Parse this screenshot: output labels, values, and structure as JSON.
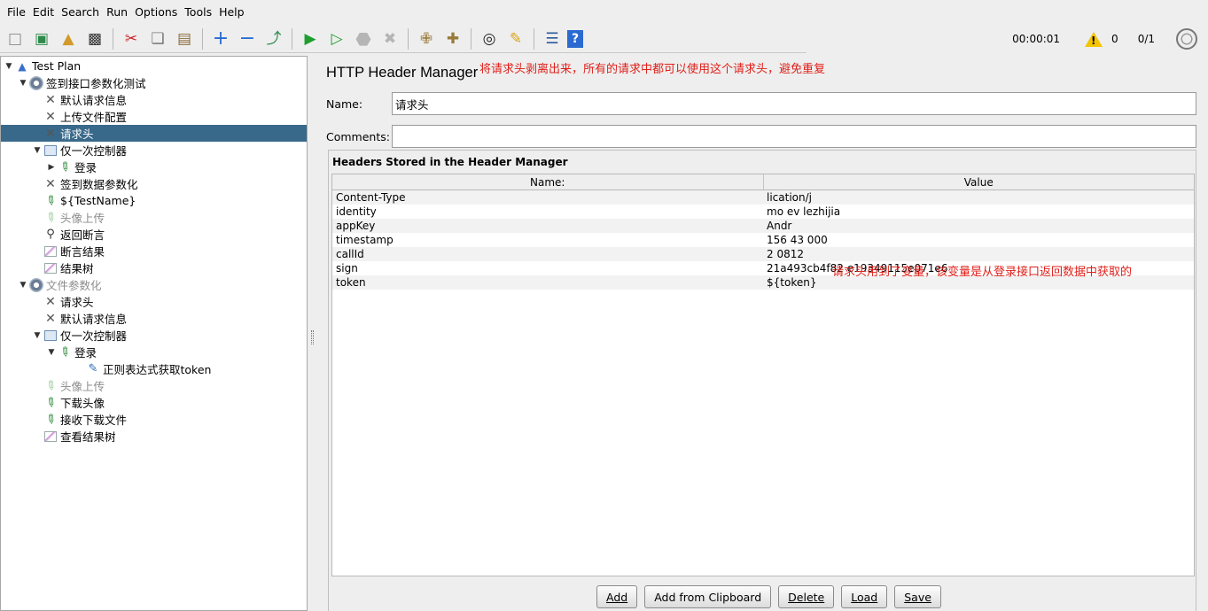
{
  "menubar": {
    "items": [
      "File",
      "Edit",
      "Search",
      "Run",
      "Options",
      "Tools",
      "Help"
    ]
  },
  "toolbar": {
    "buttons": [
      {
        "name": "new-icon",
        "glyph": "🗋"
      },
      {
        "name": "templates-icon",
        "glyph": "📚"
      },
      {
        "name": "open-icon",
        "glyph": "📂"
      },
      {
        "name": "save-icon",
        "glyph": "💾"
      },
      {
        "name": "cut-icon",
        "glyph": "✂"
      },
      {
        "name": "copy-icon",
        "glyph": "⎘"
      },
      {
        "name": "paste-icon",
        "glyph": "📋"
      },
      {
        "name": "expand-icon",
        "glyph": "+"
      },
      {
        "name": "collapse-icon",
        "glyph": "−"
      },
      {
        "name": "toggle-icon",
        "glyph": "⤨"
      },
      {
        "name": "start-icon",
        "glyph": "▶"
      },
      {
        "name": "start-no-pauses-icon",
        "glyph": "▶"
      },
      {
        "name": "stop-icon",
        "glyph": "⬣"
      },
      {
        "name": "shutdown-icon",
        "glyph": "✖"
      },
      {
        "name": "clear-icon",
        "glyph": "🧹"
      },
      {
        "name": "clear-all-icon",
        "glyph": "🧹"
      },
      {
        "name": "search-icon",
        "glyph": "🔭"
      },
      {
        "name": "reset-search-icon",
        "glyph": "🧽"
      },
      {
        "name": "function-helper-icon",
        "glyph": "☰"
      },
      {
        "name": "help-icon",
        "glyph": "?"
      }
    ],
    "timer": "00:00:01",
    "warning_count": "0",
    "threads": "0/1"
  },
  "tree": {
    "nodes": [
      {
        "label": "Test Plan",
        "icon": "flask-icon",
        "indent": 0,
        "toggle": "▼",
        "selected": false,
        "disabled": false
      },
      {
        "label": "签到接口参数化测试",
        "icon": "gear-icon",
        "indent": 1,
        "toggle": "▼",
        "selected": false,
        "disabled": false
      },
      {
        "label": "默认请求信息",
        "icon": "tools-icon",
        "indent": 2,
        "toggle": "",
        "selected": false,
        "disabled": false
      },
      {
        "label": "上传文件配置",
        "icon": "tools-icon",
        "indent": 2,
        "toggle": "",
        "selected": false,
        "disabled": false
      },
      {
        "label": "请求头",
        "icon": "tools-icon",
        "indent": 2,
        "toggle": "",
        "selected": true,
        "disabled": false
      },
      {
        "label": "仅一次控制器",
        "icon": "controller-icon",
        "indent": 2,
        "toggle": "▼",
        "selected": false,
        "disabled": false
      },
      {
        "label": "登录",
        "icon": "sampler-icon",
        "indent": 3,
        "toggle": "▶",
        "selected": false,
        "disabled": false
      },
      {
        "label": "签到数据参数化",
        "icon": "tools-icon",
        "indent": 2,
        "toggle": "",
        "selected": false,
        "disabled": false
      },
      {
        "label": "${TestName}",
        "icon": "sampler-icon",
        "indent": 2,
        "toggle": "",
        "selected": false,
        "disabled": false
      },
      {
        "label": "头像上传",
        "icon": "sampler-icon",
        "indent": 2,
        "toggle": "",
        "selected": false,
        "disabled": true
      },
      {
        "label": "返回断言",
        "icon": "search-icon",
        "indent": 2,
        "toggle": "",
        "selected": false,
        "disabled": false
      },
      {
        "label": "断言结果",
        "icon": "graph-icon",
        "indent": 2,
        "toggle": "",
        "selected": false,
        "disabled": false
      },
      {
        "label": "结果树",
        "icon": "graph-icon",
        "indent": 2,
        "toggle": "",
        "selected": false,
        "disabled": false
      },
      {
        "label": "文件参数化",
        "icon": "gear-icon",
        "indent": 1,
        "toggle": "▼",
        "selected": false,
        "disabled": true
      },
      {
        "label": "请求头",
        "icon": "tools-icon",
        "indent": 2,
        "toggle": "",
        "selected": false,
        "disabled": false
      },
      {
        "label": "默认请求信息",
        "icon": "tools-icon",
        "indent": 2,
        "toggle": "",
        "selected": false,
        "disabled": false
      },
      {
        "label": "仅一次控制器",
        "icon": "controller-icon",
        "indent": 2,
        "toggle": "▼",
        "selected": false,
        "disabled": false
      },
      {
        "label": "登录",
        "icon": "sampler-icon",
        "indent": 3,
        "toggle": "▼",
        "selected": false,
        "disabled": false
      },
      {
        "label": "正则表达式获取token",
        "icon": "doc-icon",
        "indent": 5,
        "toggle": "",
        "selected": false,
        "disabled": false
      },
      {
        "label": "头像上传",
        "icon": "sampler-icon",
        "indent": 2,
        "toggle": "",
        "selected": false,
        "disabled": true
      },
      {
        "label": "下载头像",
        "icon": "sampler-icon",
        "indent": 2,
        "toggle": "",
        "selected": false,
        "disabled": false
      },
      {
        "label": "接收下载文件",
        "icon": "sampler-icon",
        "indent": 2,
        "toggle": "",
        "selected": false,
        "disabled": false
      },
      {
        "label": "查看结果树",
        "icon": "graph-icon",
        "indent": 2,
        "toggle": "",
        "selected": false,
        "disabled": false
      }
    ]
  },
  "panel": {
    "title": "HTTP Header Manager",
    "annotation_top": "将请求头剥离出来，所有的请求中都可以使用这个请求头，避免重复",
    "name_label": "Name:",
    "name_value": "请求头",
    "comments_label": "Comments:",
    "comments_value": "",
    "headers_title": "Headers Stored in the Header Manager",
    "col_name": "Name:",
    "col_value": "Value",
    "rows": [
      {
        "name": "Content-Type",
        "value": "lication/j"
      },
      {
        "name": "identity",
        "value": "mo ev lezhijia"
      },
      {
        "name": "appKey",
        "value": "Andr"
      },
      {
        "name": "timestamp",
        "value": "156 43 000"
      },
      {
        "name": "callId",
        "value": "2 0812"
      },
      {
        "name": "sign",
        "value": "21a493cb4f82 e19349115e071e6"
      },
      {
        "name": "token",
        "value": "${token}"
      }
    ],
    "annotation_token": "请求头用到了变量，该变量是从登录接口返回数据中获取的",
    "buttons": {
      "add": "Add",
      "add_clipboard": "Add from Clipboard",
      "delete": "Delete",
      "load": "Load",
      "save": "Save"
    }
  }
}
